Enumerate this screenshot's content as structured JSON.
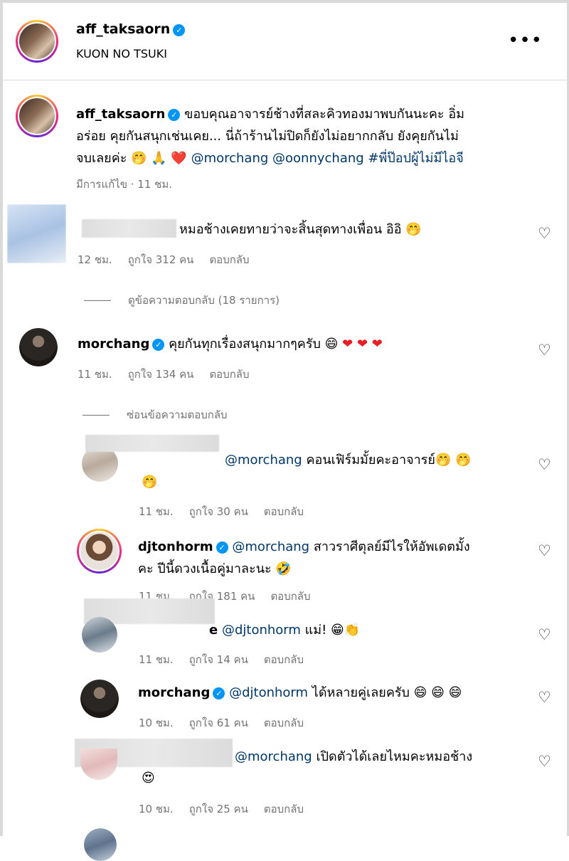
{
  "post": {
    "author": "aff_taksaorn",
    "location": "KUON NO TSUKI",
    "more_icon": "more-horizontal-icon"
  },
  "caption": {
    "username": "aff_taksaorn",
    "line1": "ขอบคุณอาจารย์ช้างที่สละคิวทองมาพบกันนะคะ อิ่ม",
    "line2": "อร่อย คุยกันสนุกเช่นเคย... นี่ถ้าร้านไม่ปิดก็ยังไม่อยากกลับ ยังคุยกันไม่",
    "line3_text": "จบเลยค่ะ",
    "line3_emojis": "🤭 🙏 ❤️",
    "line3_tags": "@morchang @oonnychang #พี่ป๊อปผู้ไม่มีไอจี",
    "meta": "มีการแก้ไข · 11 ชม."
  },
  "comments": [
    {
      "text": "หมอช้างเคยทายว่าจะสิ้นสุดทางเพื่อน อิอิ 🤭",
      "time": "12 ชม.",
      "likes": "ถูกใจ 312 คน",
      "reply": "ตอบกลับ"
    },
    {
      "view_replies": "ดูข้อความตอบกลับ (18 รายการ)"
    },
    {
      "username": "morchang",
      "text": "คุยกันทุกเรื่องสนุกมากๆครับ 😄",
      "hearts": "❤ ❤ ❤",
      "time": "11 ชม.",
      "likes": "ถูกใจ 134 คน",
      "reply": "ตอบกลับ"
    },
    {
      "hide_replies": "ซ่อนข้อความตอบกลับ"
    }
  ],
  "replies": [
    {
      "mention": "@morchang",
      "text": "คอนเฟิร์มมั้ยคะอาจารย์🤭 🤭",
      "text2": "🤭",
      "time": "11 ชม.",
      "likes": "ถูกใจ 30 คน",
      "reply": "ตอบกลับ"
    },
    {
      "username": "djtonhorm",
      "mention": "@morchang",
      "text": "สาวราศีตุลย์มีไรให้อัพเดตมั้ง",
      "text2": "คะ ปีนี้ดวงเนื้อคู่มาละนะ 🤣",
      "time": "11 ชม.",
      "likes": "ถูกใจ 181 คน",
      "reply": "ตอบกลับ"
    },
    {
      "name_fragment": "e",
      "mention": "@djtonhorm",
      "text": "แม่! 😁👏",
      "time": "11 ชม.",
      "likes": "ถูกใจ 14 คน",
      "reply": "ตอบกลับ"
    },
    {
      "username": "morchang",
      "mention": "@djtonhorm",
      "text": "ได้หลายคู่เลยครับ 😄 😄 😄",
      "time": "10 ชม.",
      "likes": "ถูกใจ 61 คน",
      "reply": "ตอบกลับ"
    },
    {
      "mention": "@morchang",
      "text": "เปิดตัวได้เลยไหมคะหมอช้าง",
      "text2": "😍",
      "time": "10 ชม.",
      "likes": "ถูกใจ 25 คน",
      "reply": "ตอบกลับ"
    }
  ],
  "icons": {
    "verified": "verified-badge-icon",
    "like": "heart-outline-icon"
  },
  "colors": {
    "link": "#00376b",
    "verified": "#0095f6",
    "meta": "#737373",
    "heart_red": "#ed1c24"
  }
}
